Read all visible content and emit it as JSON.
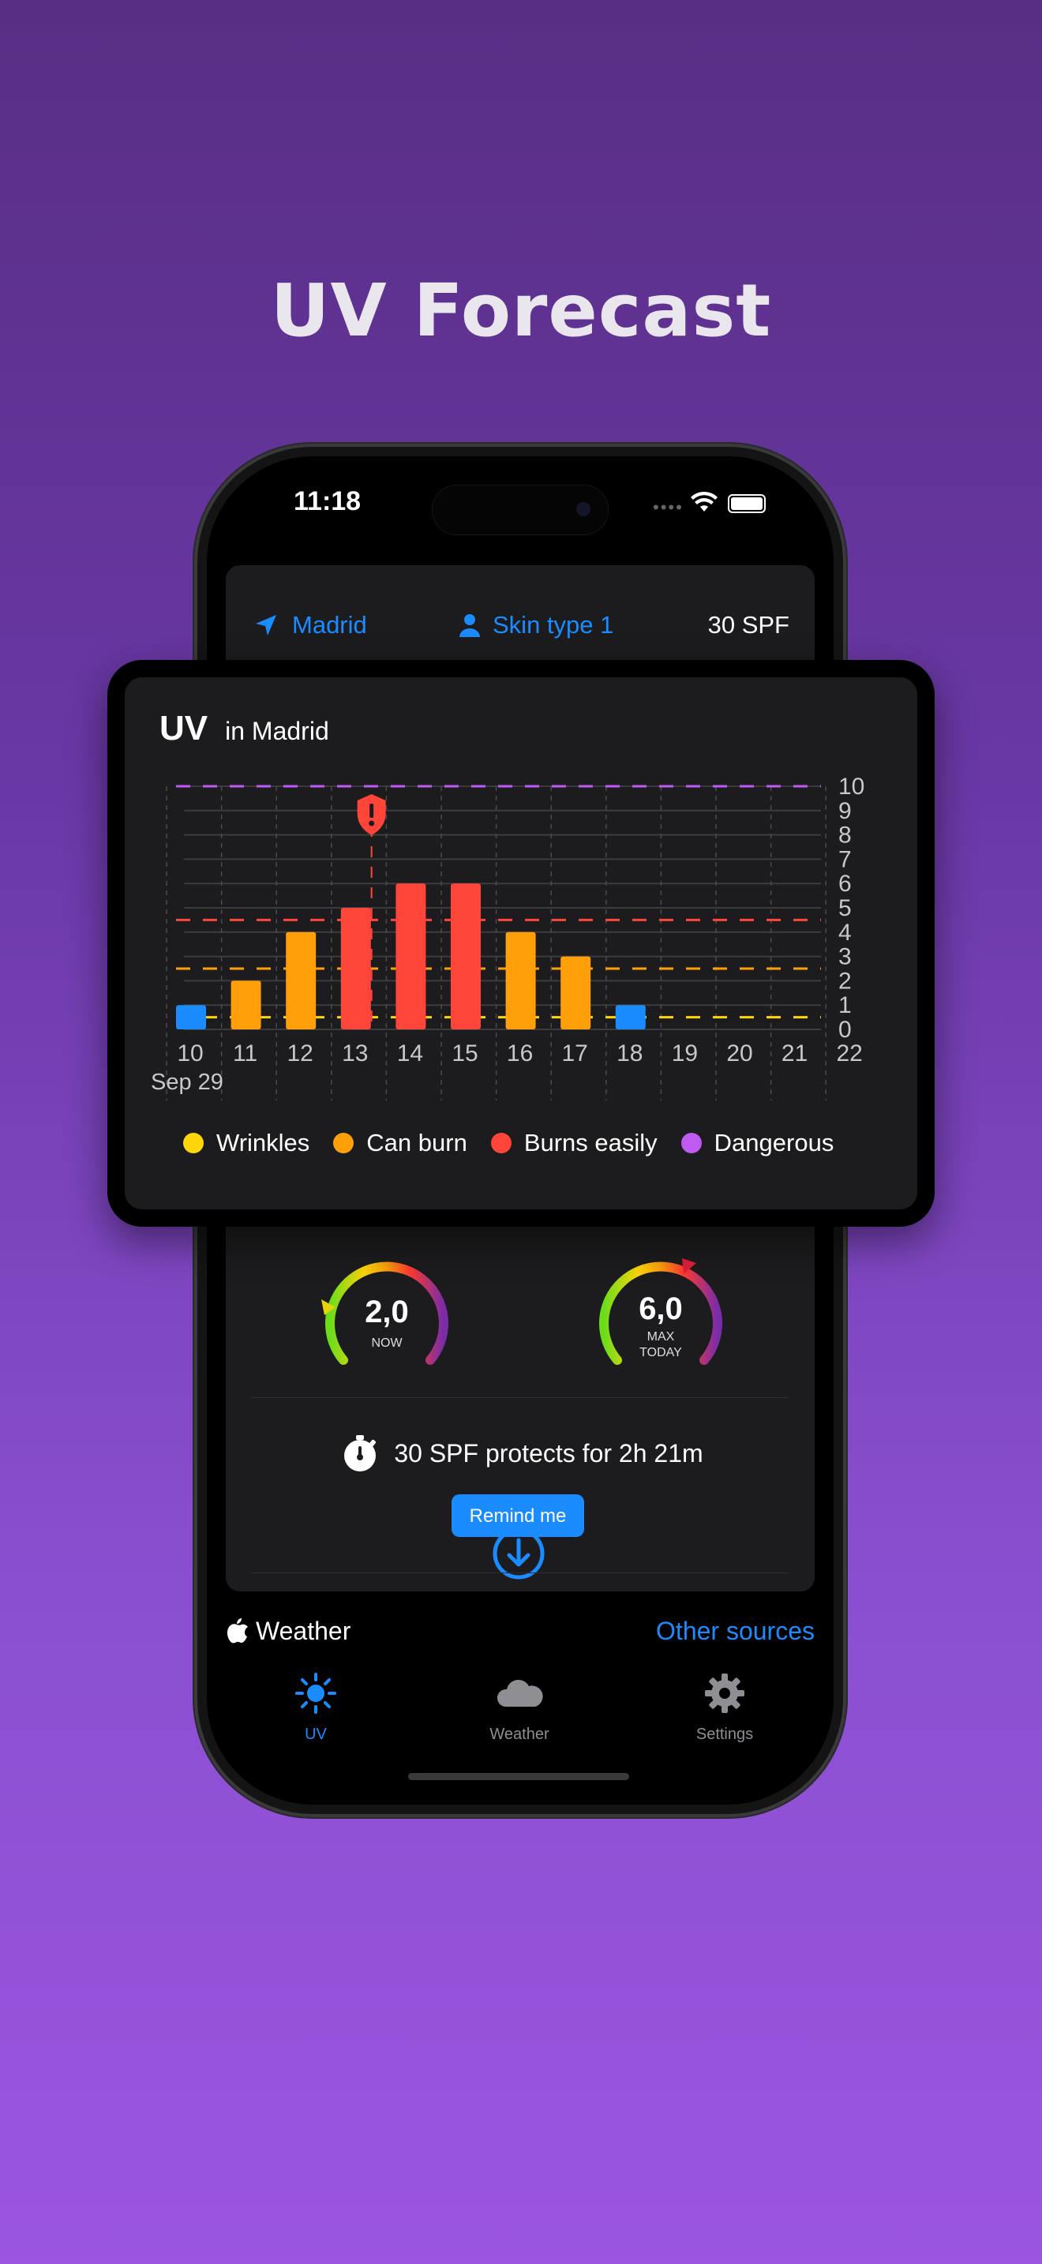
{
  "headline": "UV Forecast",
  "status": {
    "time": "11:18"
  },
  "topbar": {
    "location": "Madrid",
    "skin_type": "Skin type 1",
    "spf": "30 SPF"
  },
  "chart_card": {
    "title": "UV",
    "subtitle": "in Madrid"
  },
  "chart_data": {
    "type": "bar",
    "categories": [
      "10",
      "11",
      "12",
      "13",
      "14",
      "15",
      "16",
      "17",
      "18",
      "19",
      "20",
      "21",
      "22"
    ],
    "date_label": "Sep 29",
    "values": [
      1,
      2,
      4,
      5,
      6,
      6,
      4,
      3,
      1,
      0,
      0,
      0,
      0
    ],
    "bar_colors": [
      "#1a8cff",
      "#ff9f0a",
      "#ff9f0a",
      "#ff453a",
      "#ff453a",
      "#ff453a",
      "#ff9f0a",
      "#ff9f0a",
      "#1a8cff",
      "",
      "",
      "",
      ""
    ],
    "ylim": [
      0,
      10
    ],
    "yticks": [
      "0",
      "1",
      "2",
      "3",
      "4",
      "5",
      "6",
      "7",
      "8",
      "9",
      "10"
    ],
    "thresholds": [
      {
        "value": 0.5,
        "color": "#ffd60a"
      },
      {
        "value": 2.5,
        "color": "#ff9f0a"
      },
      {
        "value": 4.5,
        "color": "#ff453a"
      },
      {
        "value": 10,
        "color": "#bf5af2"
      }
    ],
    "now_marker": "13:30",
    "grid": true
  },
  "legend": [
    {
      "label": "Wrinkles",
      "color": "#ffd60a"
    },
    {
      "label": "Can burn",
      "color": "#ff9f0a"
    },
    {
      "label": "Burns easily",
      "color": "#ff453a"
    },
    {
      "label": "Dangerous",
      "color": "#bf5af2"
    }
  ],
  "gauges": {
    "now": {
      "value": "2,0",
      "label": "NOW",
      "level": 0.2
    },
    "max": {
      "value": "6,0",
      "label_1": "MAX",
      "label_2": "TODAY",
      "level": 0.6
    }
  },
  "protection": {
    "text": "30 SPF protects for 2h  21m",
    "remind_label": "Remind me"
  },
  "footer": {
    "weather_label": "Weather",
    "other_sources": "Other sources"
  },
  "tabs": [
    {
      "label": "UV",
      "active": true
    },
    {
      "label": "Weather",
      "active": false
    },
    {
      "label": "Settings",
      "active": false
    }
  ]
}
